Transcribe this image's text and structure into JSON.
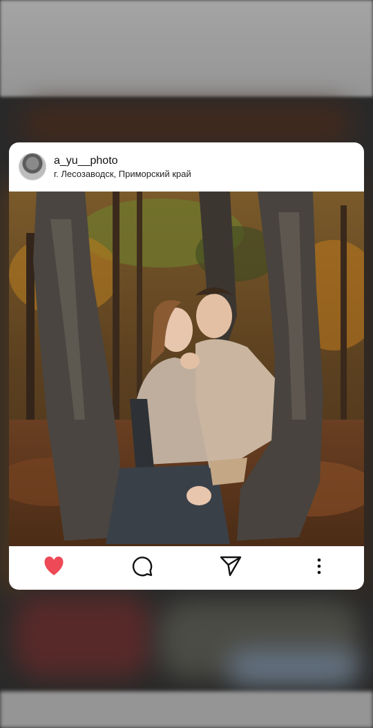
{
  "post": {
    "username": "a_yu__photo",
    "location": "г. Лесозаводск, Приморский край",
    "liked": true
  },
  "icons": {
    "like": "heart-icon",
    "comment": "comment-icon",
    "share": "send-icon",
    "more": "more-vertical-icon"
  },
  "colors": {
    "like_red": "#ed4956",
    "card_bg": "#ffffff"
  }
}
